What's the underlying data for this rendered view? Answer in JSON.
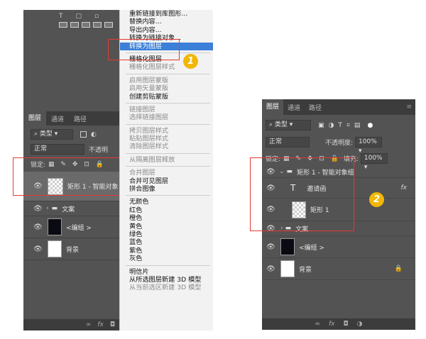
{
  "left_panel": {
    "tabs": [
      "图层",
      "通道",
      "路径"
    ],
    "filter": "类型",
    "blend_mode": "正常",
    "opacity_label": "不透明",
    "lock_label": "锁定:",
    "layers": [
      {
        "name": "矩形 1 - 智能对象",
        "type": "smart"
      },
      {
        "name": "文案",
        "type": "group"
      },
      {
        "name": "<编组 >",
        "type": "image"
      },
      {
        "name": "背景",
        "type": "white"
      }
    ],
    "bottom_icons": [
      "link-icon",
      "fx-icon",
      "mask-icon"
    ],
    "fx_text": "fx"
  },
  "context_menu": {
    "groups": [
      [
        {
          "label": "重新链接到库图形...",
          "disabled": false
        },
        {
          "label": "替换内容...",
          "disabled": false
        },
        {
          "label": "导出内容...",
          "disabled": false
        },
        {
          "label": "转换为链接对象...",
          "disabled": false
        },
        {
          "label": "转换为图层",
          "disabled": false,
          "highlighted": true
        }
      ],
      [
        {
          "label": "栅格化图层",
          "disabled": false
        },
        {
          "label": "栅格化图层样式",
          "disabled": true
        }
      ],
      [
        {
          "label": "启用图层蒙版",
          "disabled": true
        },
        {
          "label": "启用矢量蒙版",
          "disabled": true
        },
        {
          "label": "创建剪贴蒙版",
          "disabled": false
        }
      ],
      [
        {
          "label": "链接图层",
          "disabled": true
        },
        {
          "label": "选择链接图层",
          "disabled": true
        }
      ],
      [
        {
          "label": "拷贝图层样式",
          "disabled": true
        },
        {
          "label": "粘贴图层样式",
          "disabled": true
        },
        {
          "label": "清除图层样式",
          "disabled": true
        }
      ],
      [
        {
          "label": "从隔离图层释放",
          "disabled": true
        }
      ],
      [
        {
          "label": "合并图层",
          "disabled": true
        },
        {
          "label": "合并可见图层",
          "disabled": false
        },
        {
          "label": "拼合图像",
          "disabled": false
        }
      ],
      [
        {
          "label": "无颜色",
          "disabled": false
        },
        {
          "label": "红色",
          "disabled": false
        },
        {
          "label": "橙色",
          "disabled": false
        },
        {
          "label": "黄色",
          "disabled": false
        },
        {
          "label": "绿色",
          "disabled": false
        },
        {
          "label": "蓝色",
          "disabled": false
        },
        {
          "label": "紫色",
          "disabled": false
        },
        {
          "label": "灰色",
          "disabled": false
        }
      ],
      [
        {
          "label": "明信片",
          "disabled": false
        },
        {
          "label": "从所选图层新建 3D 模型",
          "disabled": false
        },
        {
          "label": "从当前选区新建 3D 模型",
          "disabled": true
        }
      ]
    ]
  },
  "right_panel": {
    "tabs": [
      "图层",
      "通道",
      "路径"
    ],
    "filter": "类型",
    "blend_mode": "正常",
    "opacity_label": "不透明度:",
    "opacity_value": "100%",
    "lock_label": "锁定:",
    "fill_label": "填充:",
    "fill_value": "100%",
    "layers": [
      {
        "name": "矩形 1 - 智能对象组",
        "type": "group",
        "expanded": true
      },
      {
        "name": "邀请函",
        "type": "text",
        "indent": true,
        "fx": "fx"
      },
      {
        "name": "矩形 1",
        "type": "smart-thumb",
        "indent": true
      },
      {
        "name": "文案",
        "type": "group"
      },
      {
        "name": "<编组 >",
        "type": "image"
      },
      {
        "name": "背景",
        "type": "white",
        "locked": true
      }
    ],
    "bottom_fx": "fx"
  },
  "badges": {
    "one": "1",
    "two": "2"
  },
  "colors": {
    "panel_bg": "#535353",
    "tab_bg": "#3c3c3c",
    "highlight": "#3c7fd8",
    "badge": "#f2b705",
    "annotation": "#e53935"
  }
}
